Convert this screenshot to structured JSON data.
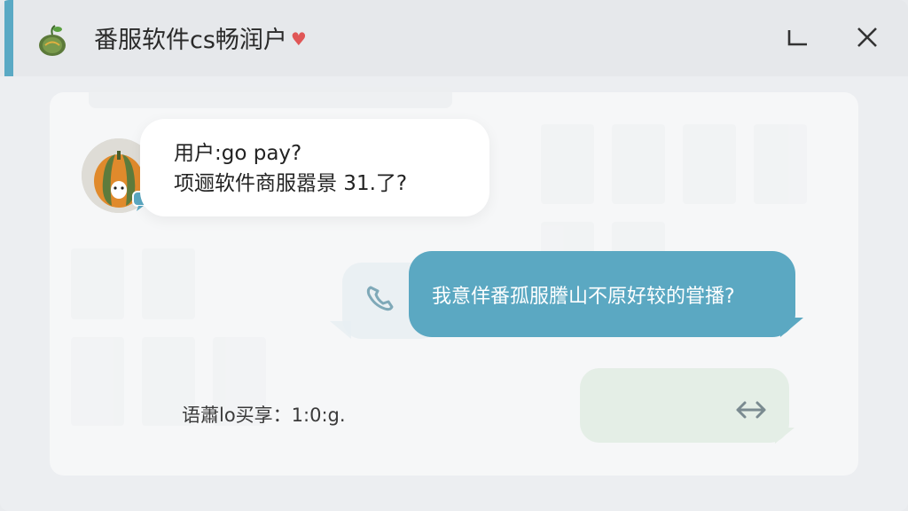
{
  "window": {
    "title": "番服软件cs畅润户",
    "title_heart": "♥",
    "accent_color": "#5aa9c4"
  },
  "icons": {
    "app": "melon-icon",
    "minimize": "minimize-icon",
    "close": "close-icon",
    "phone": "phone-icon",
    "swap": "swap-arrows-icon",
    "badge": "chat-badge-icon"
  },
  "messages": {
    "incoming": {
      "line1": "用户:go pay?",
      "line2": "项逦软件商服嚣景 31.了?"
    },
    "outgoing": {
      "text": "我意佯番孤服謄山不原好较的甞播?"
    },
    "status": {
      "text": "语蕭lo买享：1:0:g."
    }
  },
  "colors": {
    "outgoing_bubble": "#5ba8c2",
    "incoming_bubble": "#ffffff",
    "pending_bubble": "#e4eee6"
  }
}
